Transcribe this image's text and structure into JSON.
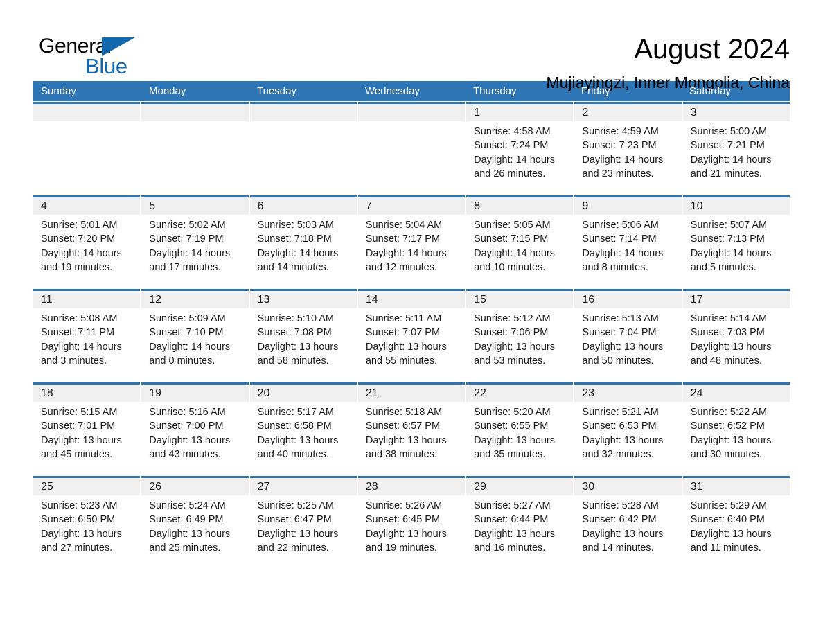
{
  "brand": {
    "name_part1": "General",
    "name_part2": "Blue",
    "accent_color": "#1268ad"
  },
  "header": {
    "month_title": "August 2024",
    "location": "Mujiayingzi, Inner Mongolia, China"
  },
  "theme": {
    "header_blue": "#2e75b6",
    "day_band_gray": "#f0f0f0",
    "text_color": "#1a1a1a"
  },
  "calendar": {
    "weekdays": [
      "Sunday",
      "Monday",
      "Tuesday",
      "Wednesday",
      "Thursday",
      "Friday",
      "Saturday"
    ],
    "weeks": [
      [
        {
          "day": "",
          "empty": true
        },
        {
          "day": "",
          "empty": true
        },
        {
          "day": "",
          "empty": true
        },
        {
          "day": "",
          "empty": true
        },
        {
          "day": "1",
          "sunrise": "Sunrise: 4:58 AM",
          "sunset": "Sunset: 7:24 PM",
          "daylight_line1": "Daylight: 14 hours",
          "daylight_line2": "and 26 minutes."
        },
        {
          "day": "2",
          "sunrise": "Sunrise: 4:59 AM",
          "sunset": "Sunset: 7:23 PM",
          "daylight_line1": "Daylight: 14 hours",
          "daylight_line2": "and 23 minutes."
        },
        {
          "day": "3",
          "sunrise": "Sunrise: 5:00 AM",
          "sunset": "Sunset: 7:21 PM",
          "daylight_line1": "Daylight: 14 hours",
          "daylight_line2": "and 21 minutes."
        }
      ],
      [
        {
          "day": "4",
          "sunrise": "Sunrise: 5:01 AM",
          "sunset": "Sunset: 7:20 PM",
          "daylight_line1": "Daylight: 14 hours",
          "daylight_line2": "and 19 minutes."
        },
        {
          "day": "5",
          "sunrise": "Sunrise: 5:02 AM",
          "sunset": "Sunset: 7:19 PM",
          "daylight_line1": "Daylight: 14 hours",
          "daylight_line2": "and 17 minutes."
        },
        {
          "day": "6",
          "sunrise": "Sunrise: 5:03 AM",
          "sunset": "Sunset: 7:18 PM",
          "daylight_line1": "Daylight: 14 hours",
          "daylight_line2": "and 14 minutes."
        },
        {
          "day": "7",
          "sunrise": "Sunrise: 5:04 AM",
          "sunset": "Sunset: 7:17 PM",
          "daylight_line1": "Daylight: 14 hours",
          "daylight_line2": "and 12 minutes."
        },
        {
          "day": "8",
          "sunrise": "Sunrise: 5:05 AM",
          "sunset": "Sunset: 7:15 PM",
          "daylight_line1": "Daylight: 14 hours",
          "daylight_line2": "and 10 minutes."
        },
        {
          "day": "9",
          "sunrise": "Sunrise: 5:06 AM",
          "sunset": "Sunset: 7:14 PM",
          "daylight_line1": "Daylight: 14 hours",
          "daylight_line2": "and 8 minutes."
        },
        {
          "day": "10",
          "sunrise": "Sunrise: 5:07 AM",
          "sunset": "Sunset: 7:13 PM",
          "daylight_line1": "Daylight: 14 hours",
          "daylight_line2": "and 5 minutes."
        }
      ],
      [
        {
          "day": "11",
          "sunrise": "Sunrise: 5:08 AM",
          "sunset": "Sunset: 7:11 PM",
          "daylight_line1": "Daylight: 14 hours",
          "daylight_line2": "and 3 minutes."
        },
        {
          "day": "12",
          "sunrise": "Sunrise: 5:09 AM",
          "sunset": "Sunset: 7:10 PM",
          "daylight_line1": "Daylight: 14 hours",
          "daylight_line2": "and 0 minutes."
        },
        {
          "day": "13",
          "sunrise": "Sunrise: 5:10 AM",
          "sunset": "Sunset: 7:08 PM",
          "daylight_line1": "Daylight: 13 hours",
          "daylight_line2": "and 58 minutes."
        },
        {
          "day": "14",
          "sunrise": "Sunrise: 5:11 AM",
          "sunset": "Sunset: 7:07 PM",
          "daylight_line1": "Daylight: 13 hours",
          "daylight_line2": "and 55 minutes."
        },
        {
          "day": "15",
          "sunrise": "Sunrise: 5:12 AM",
          "sunset": "Sunset: 7:06 PM",
          "daylight_line1": "Daylight: 13 hours",
          "daylight_line2": "and 53 minutes."
        },
        {
          "day": "16",
          "sunrise": "Sunrise: 5:13 AM",
          "sunset": "Sunset: 7:04 PM",
          "daylight_line1": "Daylight: 13 hours",
          "daylight_line2": "and 50 minutes."
        },
        {
          "day": "17",
          "sunrise": "Sunrise: 5:14 AM",
          "sunset": "Sunset: 7:03 PM",
          "daylight_line1": "Daylight: 13 hours",
          "daylight_line2": "and 48 minutes."
        }
      ],
      [
        {
          "day": "18",
          "sunrise": "Sunrise: 5:15 AM",
          "sunset": "Sunset: 7:01 PM",
          "daylight_line1": "Daylight: 13 hours",
          "daylight_line2": "and 45 minutes."
        },
        {
          "day": "19",
          "sunrise": "Sunrise: 5:16 AM",
          "sunset": "Sunset: 7:00 PM",
          "daylight_line1": "Daylight: 13 hours",
          "daylight_line2": "and 43 minutes."
        },
        {
          "day": "20",
          "sunrise": "Sunrise: 5:17 AM",
          "sunset": "Sunset: 6:58 PM",
          "daylight_line1": "Daylight: 13 hours",
          "daylight_line2": "and 40 minutes."
        },
        {
          "day": "21",
          "sunrise": "Sunrise: 5:18 AM",
          "sunset": "Sunset: 6:57 PM",
          "daylight_line1": "Daylight: 13 hours",
          "daylight_line2": "and 38 minutes."
        },
        {
          "day": "22",
          "sunrise": "Sunrise: 5:20 AM",
          "sunset": "Sunset: 6:55 PM",
          "daylight_line1": "Daylight: 13 hours",
          "daylight_line2": "and 35 minutes."
        },
        {
          "day": "23",
          "sunrise": "Sunrise: 5:21 AM",
          "sunset": "Sunset: 6:53 PM",
          "daylight_line1": "Daylight: 13 hours",
          "daylight_line2": "and 32 minutes."
        },
        {
          "day": "24",
          "sunrise": "Sunrise: 5:22 AM",
          "sunset": "Sunset: 6:52 PM",
          "daylight_line1": "Daylight: 13 hours",
          "daylight_line2": "and 30 minutes."
        }
      ],
      [
        {
          "day": "25",
          "sunrise": "Sunrise: 5:23 AM",
          "sunset": "Sunset: 6:50 PM",
          "daylight_line1": "Daylight: 13 hours",
          "daylight_line2": "and 27 minutes."
        },
        {
          "day": "26",
          "sunrise": "Sunrise: 5:24 AM",
          "sunset": "Sunset: 6:49 PM",
          "daylight_line1": "Daylight: 13 hours",
          "daylight_line2": "and 25 minutes."
        },
        {
          "day": "27",
          "sunrise": "Sunrise: 5:25 AM",
          "sunset": "Sunset: 6:47 PM",
          "daylight_line1": "Daylight: 13 hours",
          "daylight_line2": "and 22 minutes."
        },
        {
          "day": "28",
          "sunrise": "Sunrise: 5:26 AM",
          "sunset": "Sunset: 6:45 PM",
          "daylight_line1": "Daylight: 13 hours",
          "daylight_line2": "and 19 minutes."
        },
        {
          "day": "29",
          "sunrise": "Sunrise: 5:27 AM",
          "sunset": "Sunset: 6:44 PM",
          "daylight_line1": "Daylight: 13 hours",
          "daylight_line2": "and 16 minutes."
        },
        {
          "day": "30",
          "sunrise": "Sunrise: 5:28 AM",
          "sunset": "Sunset: 6:42 PM",
          "daylight_line1": "Daylight: 13 hours",
          "daylight_line2": "and 14 minutes."
        },
        {
          "day": "31",
          "sunrise": "Sunrise: 5:29 AM",
          "sunset": "Sunset: 6:40 PM",
          "daylight_line1": "Daylight: 13 hours",
          "daylight_line2": "and 11 minutes."
        }
      ]
    ]
  }
}
